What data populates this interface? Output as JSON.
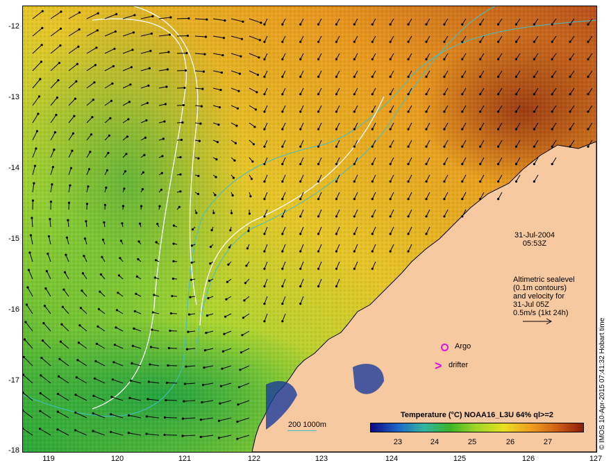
{
  "map": {
    "y_axis_labels": [
      "-12",
      "-13",
      "-14",
      "-15",
      "-16",
      "-17",
      "-18"
    ],
    "x_axis_labels": [
      "119",
      "120",
      "121",
      "122",
      "123",
      "124",
      "125",
      "126",
      "127"
    ],
    "lon_range": [
      118.6,
      127
    ],
    "lat_range": [
      -18,
      -11.8
    ],
    "date": "31-Jul-2004",
    "time": "05:53Z",
    "info_lines": [
      "Altimetric sealevel",
      "(0.1m contours)",
      "and velocity for",
      "31-Jul 05Z",
      "0.5m/s (1kt 24h)"
    ],
    "argo_label": "Argo",
    "drifter_label": "drifter",
    "depth_contour_label": "200  1000m",
    "credit": "© IMOS 10-Apr-2015 07:41:32 Hobart time",
    "marker_color": "#e010e0",
    "land_color": "#f7c9a0"
  },
  "legend": {
    "title": "Temperature (°C) NOAA16_L3U 64% ql>=2",
    "ticks": [
      "23",
      "24",
      "25",
      "26",
      "27"
    ],
    "tick_values": [
      23,
      24,
      25,
      26,
      27
    ],
    "range": [
      22.2,
      28
    ],
    "colors": [
      "#0a0a80",
      "#1e64c8",
      "#30b4a0",
      "#3cb428",
      "#a0d828",
      "#e8e020",
      "#f0a020",
      "#d06010",
      "#8c1e0a"
    ]
  }
}
